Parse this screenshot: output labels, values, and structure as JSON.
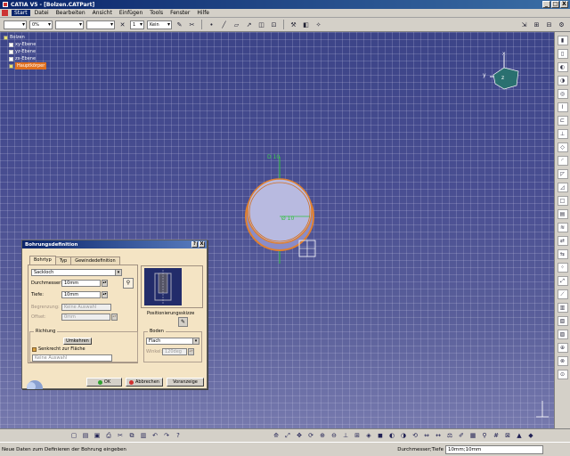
{
  "window": {
    "title": "CATIA V5 - [Bolzen.CATPart]",
    "min": "_",
    "max": "□",
    "close": "X"
  },
  "menu": [
    "Start",
    "Datei",
    "Bearbeiten",
    "Ansicht",
    "Einfügen",
    "Tools",
    "Fenster",
    "Hilfe"
  ],
  "toolbar": {
    "color_combo": "",
    "transparency_combo": "0%",
    "linetype_combo": "",
    "lineweight_combo": "",
    "layer_number": "1",
    "layer_combo": "Kein"
  },
  "tree": {
    "root": "Bolzen",
    "items": [
      "xy-Ebene",
      "yz-Ebene",
      "zx-Ebene"
    ],
    "highlighted": "Hauptkörper"
  },
  "compass": {
    "x": "x",
    "y": "y",
    "z": "z"
  },
  "canvas_labels": {
    "depth": "D 10",
    "diameter": "Ø 10"
  },
  "dialog": {
    "title": "Bohrungsdefinition",
    "help_btn": "?",
    "close_btn": "X",
    "tabs": [
      "Bohrtyp",
      "Typ",
      "Gewindedefinition"
    ],
    "hole_type": "Sackloch",
    "durchmesser_label": "Durchmesser:",
    "durchmesser_value": "10mm",
    "tiefe_label": "Tiefe:",
    "tiefe_value": "10mm",
    "begrenzung_label": "Begrenzung:",
    "begrenzung_value": "Keine Auswahl",
    "offset_label": "Offset:",
    "offset_value": "0mm",
    "positioning_label": "Positionierungsskizze",
    "richtung": {
      "title": "Richtung",
      "umkehren": "Umkehren",
      "senkrecht": "Senkrecht zur Fläche",
      "selection": "Keine Auswahl"
    },
    "boden": {
      "title": "Boden",
      "type": "Flach",
      "winkel_label": "Winkel:",
      "winkel_value": "120deg"
    },
    "ok": "OK",
    "abbrechen": "Abbrechen",
    "voranzeige": "Voranzeige"
  },
  "status": {
    "message": "Neue Daten zum Definieren der Bohrung eingeben",
    "field_label": "Durchmesser;Tiefe",
    "field_value": "10mm;10mm"
  },
  "colors": {
    "viewport_top": "#3c4488",
    "highlight": "#e07020",
    "hole_orange": "#e08030"
  }
}
